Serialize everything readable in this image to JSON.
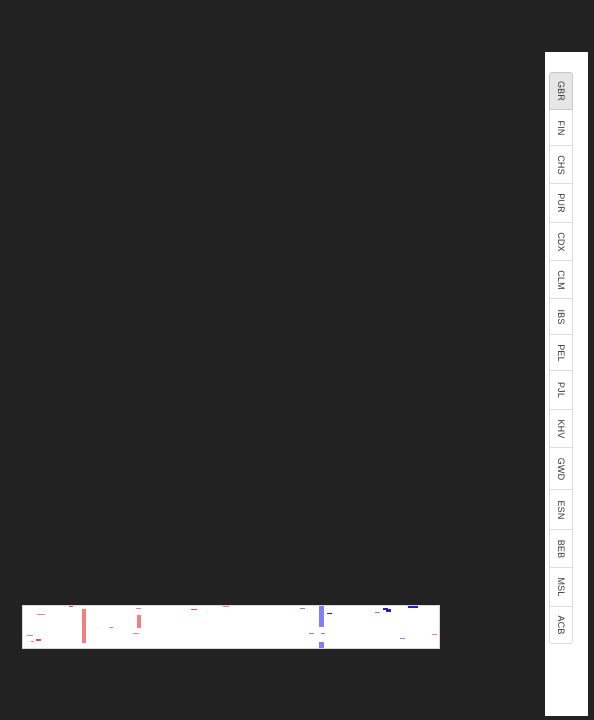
{
  "tabs": {
    "active_index": 0,
    "items": [
      {
        "label": "GBR"
      },
      {
        "label": "FIN"
      },
      {
        "label": "CHS"
      },
      {
        "label": "PUR"
      },
      {
        "label": "CDX"
      },
      {
        "label": "CLM"
      },
      {
        "label": "IBS"
      },
      {
        "label": "PEL"
      },
      {
        "label": "PJL"
      },
      {
        "label": "KHV"
      },
      {
        "label": "GWD"
      },
      {
        "label": "ESN"
      },
      {
        "label": "BEB"
      },
      {
        "label": "MSL"
      },
      {
        "label": "ACB"
      }
    ]
  },
  "colors": {
    "background": "#222222",
    "panel": "#ffffff",
    "red_mark": "#f08080",
    "blue_mark": "#8080f0",
    "dark_red_mark": "#e05050",
    "dark_blue_mark": "#2020c8"
  }
}
